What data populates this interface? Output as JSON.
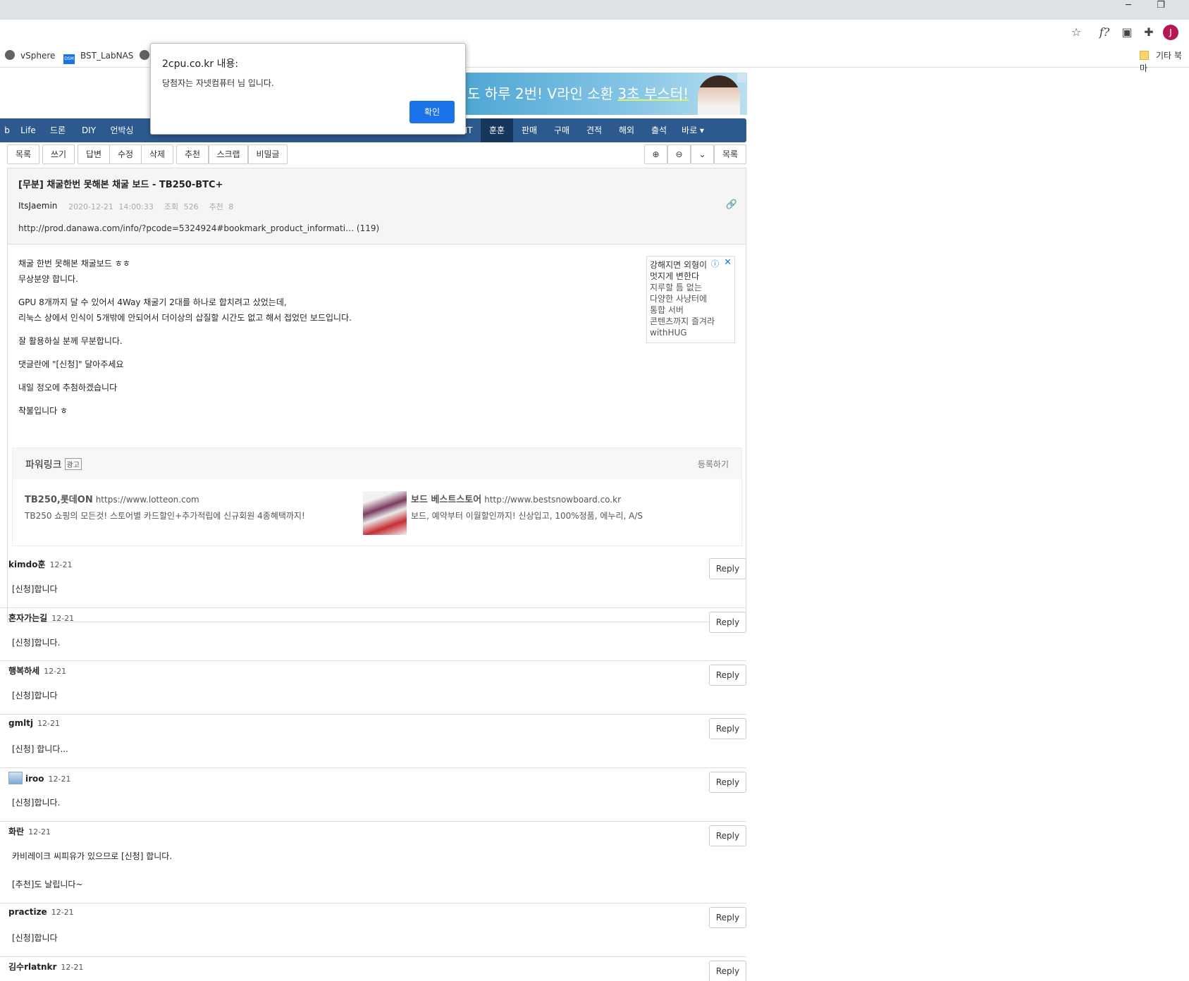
{
  "browser": {
    "toolbar_icons": [
      "star-icon",
      "fx-icon",
      "cast-icon",
      "puzzle-icon"
    ],
    "avatar_letter": "J",
    "bookmarks": [
      {
        "label": "vSphere",
        "icon": "globe-icon"
      },
      {
        "label": "BST_LabNAS",
        "icon": "dsm-icon"
      },
      {
        "label": "",
        "icon": "globe-icon"
      },
      {
        "label": "기타 북마",
        "icon": "folder-icon"
      }
    ]
  },
  "banner": {
    "text_a": "도 하루 2번!  V라인 소환 ",
    "text_b": "3초 부스터!"
  },
  "nav": {
    "items": [
      "b",
      "Life",
      "드론",
      "DIY",
      "언박싱",
      "IT",
      "훈훈",
      "판매",
      "구매",
      "견적",
      "해외",
      "출석",
      "바로 ▾"
    ],
    "active": "훈훈"
  },
  "toolbar": {
    "left": [
      "목록",
      "쓰기",
      "답변",
      "수정",
      "삭제",
      "추천",
      "스크랩",
      "비밀글"
    ],
    "right_list": "목록",
    "zoom_in_icon": "zoom-in-icon",
    "zoom_out_icon": "zoom-out-icon",
    "chevron_icon": "chevron-down-icon"
  },
  "post": {
    "title": "[무분] 채굴한번 못해본 채굴 보드 - TB250-BTC+",
    "author": "ItsJaemin",
    "datetime": "2020-12-21 14:00:33",
    "views": "조회 526",
    "recommends": "추천 8",
    "link": "http://prod.danawa.com/info/?pcode=5324924#bookmark_product_informati… (119)",
    "body": [
      "채굴 한번 못해본 채굴보드 ㅎㅎ",
      "무상분양 합니다.",
      "GPU 8개까지 달 수 있어서 4Way 채굴기 2대를 하나로 합치려고 샀었는데,",
      "리눅스 상에서 인식이 5개밖에 안되어서 더이상의 삽질할 시간도 없고 해서 접었던 보드입니다.",
      "잘 활용하실 분께 무분합니다.",
      "댓글란에 \"[신청]\" 달아주세요",
      "내일 정오에 추첨하겠습니다",
      "착불입니다 ㅎ"
    ]
  },
  "side_ad": {
    "line1": "강해지면 외형이",
    "line2": "멋지게 변한다",
    "line3": "지루할 틈 없는",
    "line4": "다양한 사냥터에",
    "line5": "통합 서버",
    "line6": "콘텐츠까지 즐겨라",
    "line7": "withHUG"
  },
  "powerlink": {
    "title": "파워링크",
    "badge": "광고",
    "register": "등록하기",
    "ads": [
      {
        "title": "TB250,롯데ON",
        "url": "https://www.lotteon.com",
        "desc": "TB250 쇼핑의 모든것! 스토어별 카드할인+추가적립에 신규회원 4종혜택까지!"
      },
      {
        "title": "보드 베스트스토어",
        "url": "http://www.bestsnowboard.co.kr",
        "desc": "보드, 예약부터 이월할인까지! 신상입고, 100%정품, 에누리, A/S"
      }
    ]
  },
  "comments": [
    {
      "name": "kimdo훈",
      "date": "12-21",
      "lines": [
        "[신청]합니다"
      ]
    },
    {
      "name": "혼자가는길",
      "date": "12-21",
      "lines": [
        "[신청]합니다."
      ]
    },
    {
      "name": "행복하세",
      "date": "12-21",
      "lines": [
        "[신청]합니다"
      ]
    },
    {
      "name": "gmltj",
      "date": "12-21",
      "lines": [
        "[신청] 합니다..."
      ]
    },
    {
      "name": "iroo",
      "date": "12-21",
      "lines": [
        "[신청]합니다."
      ]
    },
    {
      "name": "화란",
      "date": "12-21",
      "lines": [
        "카비레이크 씨피유가 있으므로 [신청] 합니다.",
        "[추천]도 날립니다~"
      ]
    },
    {
      "name": "practize",
      "date": "12-21",
      "lines": [
        "[신청]합니다"
      ]
    },
    {
      "name": "김수rlatnkr",
      "date": "12-21",
      "lines": []
    }
  ],
  "reply_label": "Reply",
  "dialog": {
    "title": "2cpu.co.kr 내용:",
    "message": "당첨자는 자넷컴퓨터 님 입니다.",
    "ok": "확인"
  }
}
